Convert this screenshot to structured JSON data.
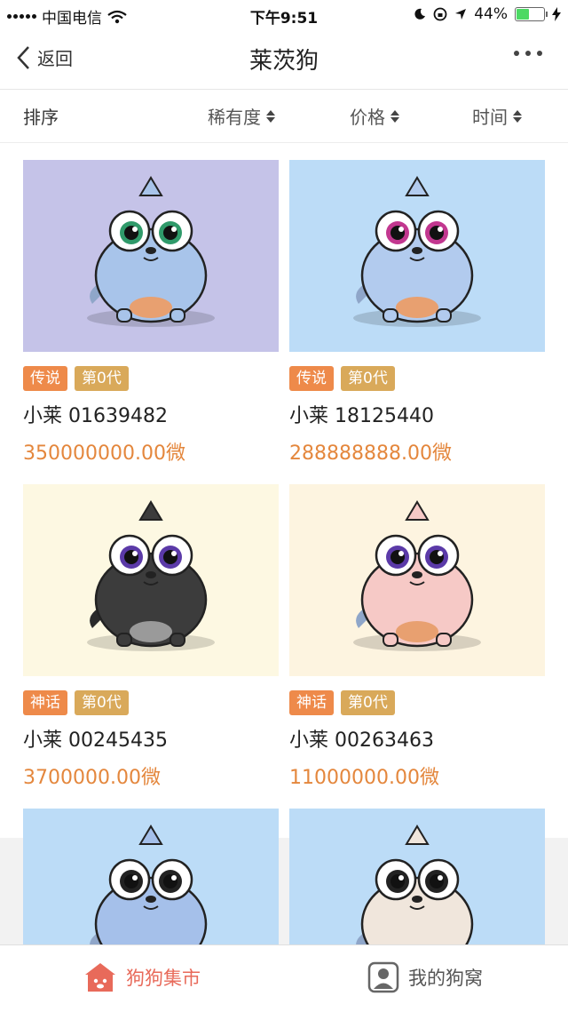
{
  "status": {
    "carrier": "中国电信",
    "time": "下午9:51",
    "battery": "44%"
  },
  "nav": {
    "back_label": "返回",
    "title": "莱茨狗"
  },
  "sort": {
    "label": "排序",
    "options": [
      {
        "label": "稀有度"
      },
      {
        "label": "价格"
      },
      {
        "label": "时间"
      }
    ]
  },
  "dogs": [
    {
      "rarity": "传说",
      "generation": "第0代",
      "name": "小莱 01639482",
      "price": "350000000.00微",
      "bg": "#c5c3e8",
      "body": "#a8c4ea",
      "eyes": "green"
    },
    {
      "rarity": "传说",
      "generation": "第0代",
      "name": "小莱 18125440",
      "price": "288888888.00微",
      "bg": "#bcdcf7",
      "body": "#b2cbee",
      "eyes": "pink"
    },
    {
      "rarity": "神话",
      "generation": "第0代",
      "name": "小莱 00245435",
      "price": "3700000.00微",
      "bg": "#fdf8e2",
      "body": "#3c3c3c",
      "eyes": "purple"
    },
    {
      "rarity": "神话",
      "generation": "第0代",
      "name": "小莱 00263463",
      "price": "11000000.00微",
      "bg": "#fdf4e0",
      "body": "#f6c9c6",
      "eyes": "purple"
    },
    {
      "bg": "#bcdcf7",
      "body": "#a5c0ea"
    },
    {
      "bg": "#bcdcf7",
      "body": "#f0e6dc"
    }
  ],
  "tabbar": {
    "market": "狗狗集市",
    "mine": "我的狗窝",
    "active_color": "#e86a5a"
  }
}
